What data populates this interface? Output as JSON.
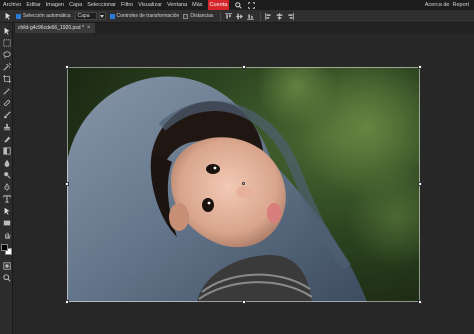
{
  "menu": {
    "items": [
      "Archivo",
      "Editar",
      "Imagen",
      "Capa",
      "Seleccionar",
      "Filtro",
      "Visualizar",
      "Ventana",
      "Más",
      "Cuenta"
    ],
    "active_index": 9,
    "right": [
      "Acerca de",
      "Report"
    ],
    "active_color": "#d7262b"
  },
  "options": {
    "auto_select_label": "Selección automática",
    "auto_select_checked": true,
    "target_value": "Capa",
    "transform_controls_label": "Controles de transformación",
    "transform_controls_checked": true,
    "distances_label": "Distancias",
    "distances_checked": false
  },
  "tab": {
    "title": "child-g4c96cde66_1920.psd *",
    "close": "×"
  },
  "icons": {
    "menu_search": "search-icon",
    "menu_fullscreen": "fullscreen-icon",
    "tool_move": "move-icon"
  },
  "colors": {
    "foreground": "#000000",
    "background": "#ffffff",
    "accent": "#2d7ad6"
  }
}
